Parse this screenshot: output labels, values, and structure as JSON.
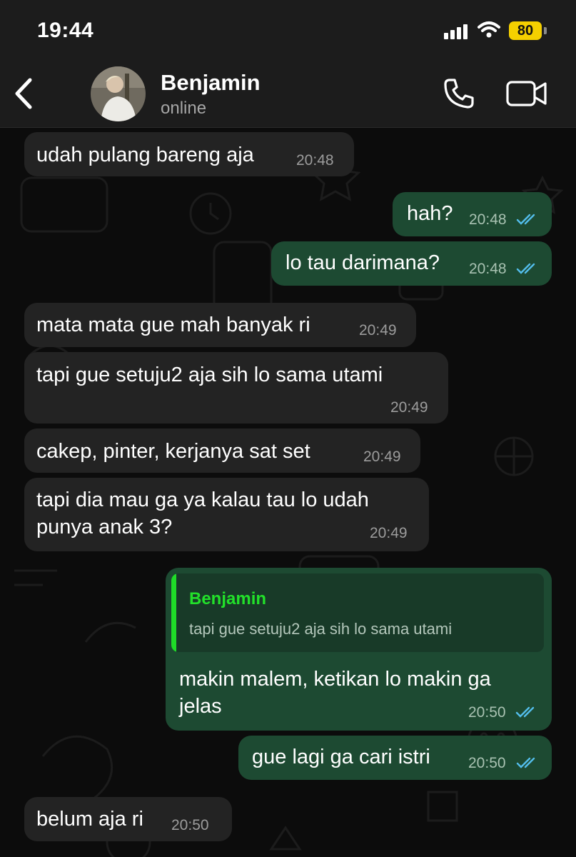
{
  "status_bar": {
    "time": "19:44",
    "battery": "80"
  },
  "header": {
    "back_icon": "chevron-left-icon",
    "name": "Benjamin",
    "status": "online",
    "call_icon": "phone-icon",
    "video_icon": "video-camera-icon"
  },
  "messages": [
    {
      "dir": "in",
      "text": "udah pulang bareng aja",
      "time": "20:48"
    },
    {
      "dir": "out",
      "text": "hah?",
      "time": "20:48",
      "read": true
    },
    {
      "dir": "out",
      "text": "lo tau darimana?",
      "time": "20:48",
      "read": true
    },
    {
      "dir": "in",
      "text": "mata mata gue mah banyak ri",
      "time": "20:49"
    },
    {
      "dir": "in",
      "text": "tapi gue setuju2 aja sih lo sama utami",
      "time": "20:49"
    },
    {
      "dir": "in",
      "text": "cakep, pinter, kerjanya sat set",
      "time": "20:49"
    },
    {
      "dir": "in",
      "lines": [
        "tapi dia mau ga ya kalau tau lo udah",
        "punya anak 3?"
      ],
      "time": "20:49"
    },
    {
      "dir": "out",
      "reply_to": {
        "name": "Benjamin",
        "text": "tapi gue setuju2 aja sih lo sama utami"
      },
      "lines": [
        "makin malem, ketikan lo makin ga",
        "jelas"
      ],
      "time": "20:50",
      "read": true
    },
    {
      "dir": "out",
      "text": "gue lagi ga cari istri",
      "time": "20:50",
      "read": true
    },
    {
      "dir": "in",
      "text": "belum aja ri",
      "time": "20:50"
    }
  ],
  "colors": {
    "incoming": "#232323",
    "outgoing": "#1d4a32",
    "read_ticks": "#53bdeb",
    "reply_accent": "#1fdc28"
  }
}
